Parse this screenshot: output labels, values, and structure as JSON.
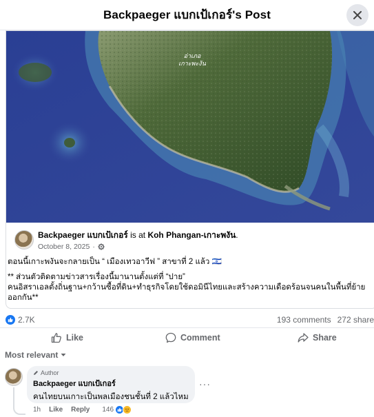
{
  "modal": {
    "title": "Backpaeger แบกเป้เกอร์'s Post"
  },
  "map": {
    "label_line1": "อ่าเภอ",
    "label_line2": "เกาะพะงัน"
  },
  "post": {
    "author": "Backpaeger แบกเป้เกอร์",
    "is_at": "is at",
    "location": "Koh Phangan-เกาะพงัน",
    "location_suffix": ".",
    "date": "October 8, 2025",
    "date_sep": "·",
    "line1": "ตอนนี้เกาะพงันจะกลายเป็น “ เมืองเทวอาวีฟ ” สาขาที่ 2 แล้ว 🇮🇱",
    "line2": "** ส่วนตัวติดตามข่าวสารเรื่องนี้มานานตั้งแต่ที่ “ปาย”",
    "line3": "คนอิสราเอลตั้งถิ่นฐาน+กว้านซื้อที่ดิน+ทำธุรกิจโดยใช้ดอมินีไทยและสร้างความเดือดร้อนจนคนในพื้นที่ย้าย",
    "line4": "ออกกัน**"
  },
  "stats": {
    "likes": "2.7K",
    "comments": "193 comments",
    "shares": "272 share"
  },
  "actions": {
    "like": "Like",
    "comment": "Comment",
    "share": "Share"
  },
  "sort": {
    "label": "Most relevant"
  },
  "comment": {
    "badge": "Author",
    "name": "Backpaeger แบกเป้เกอร์",
    "text": "คนไทยบนเกาะเป็นพลเมืองชนชั้นที่ 2 แล้วไหม",
    "more": "···",
    "time": "1h",
    "like": "Like",
    "reply": "Reply",
    "reaction_count": "146"
  },
  "colors": {
    "facebook_blue": "#1877f2",
    "text_secondary": "#65676b",
    "ocean_deep": "#2d3f8f",
    "shallow_water": "#4a8fb8"
  }
}
